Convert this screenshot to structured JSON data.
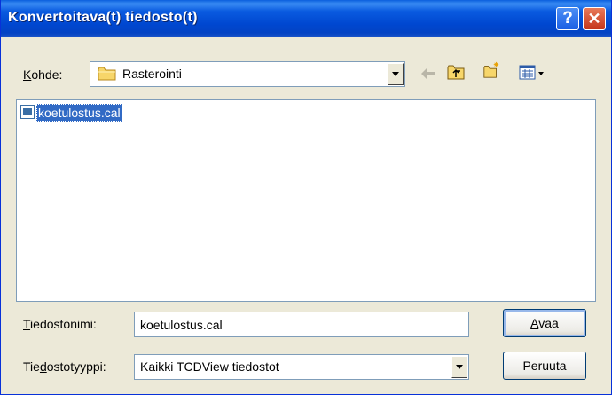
{
  "window": {
    "title": "Konvertoitava(t) tiedosto(t)",
    "help_glyph": "?",
    "close_glyph": "✕"
  },
  "lookin": {
    "label_accel": "K",
    "label_rest": "ohde:",
    "current_folder": "Rasterointi",
    "folder_icon": "folder-icon"
  },
  "toolbar": {
    "icons": [
      "back-arrow-icon",
      "up-one-level-icon",
      "new-folder-icon",
      "view-menu-icon"
    ]
  },
  "files": [
    {
      "name": "koetulostus.cal",
      "icon": "cal-file-icon",
      "selected": true
    }
  ],
  "filename": {
    "label_accel": "T",
    "label_rest": "iedostonimi:",
    "value": "koetulostus.cal"
  },
  "filetype": {
    "label_pre": "Tie",
    "label_accel": "d",
    "label_post": "ostotyyppi:",
    "value": "Kaikki TCDView tiedostot"
  },
  "buttons": {
    "open_accel": "A",
    "open_rest": "vaa",
    "cancel": "Peruuta"
  },
  "colors": {
    "titlebar": "#0a5be0",
    "selection": "#316ac5",
    "dialog_bg": "#ece9d8"
  }
}
